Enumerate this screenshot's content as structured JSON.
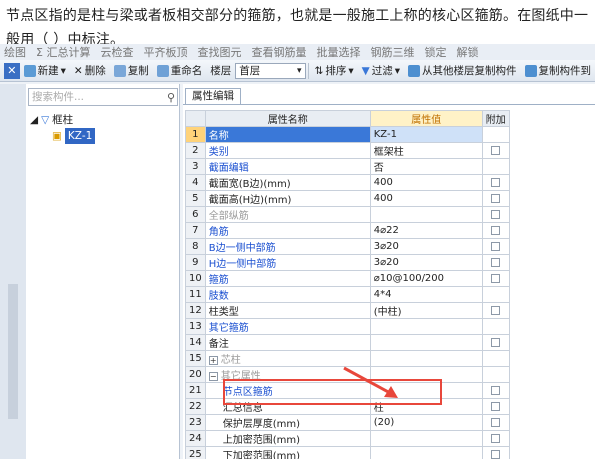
{
  "question": "节点区指的是柱与梁或者板相交部分的箍筋，也就是一般施工上称的核心区箍筋。在图纸中一般用（ ）中标注。",
  "top_toolbar": [
    "绘图",
    "Σ 汇总计算",
    "云检查",
    "平齐板顶",
    "查找图元",
    "查看钢筋量",
    "批量选择",
    "钢筋三维",
    "锁定",
    "解锁"
  ],
  "toolbar": {
    "new": "新建",
    "delete": "删除",
    "copy": "复制",
    "rename": "重命名",
    "floor_label": "楼层",
    "floor_value": "首层",
    "sort": "排序",
    "filter": "过滤",
    "copy_from_floor": "从其他楼层复制构件",
    "copy_to": "复制构件到"
  },
  "left_panel": {
    "search_placeholder": "搜索构件...",
    "tree": {
      "parent": "框柱",
      "child": "KZ-1"
    }
  },
  "property_tab": "属性编辑",
  "grid": {
    "headers": {
      "name": "属性名称",
      "value": "属性值",
      "add": "附加"
    },
    "rows": [
      {
        "num": "1",
        "name": "名称",
        "value": "KZ-1",
        "style": "link",
        "checkbox": false,
        "selected": true
      },
      {
        "num": "2",
        "name": "类别",
        "value": "框架柱",
        "style": "link",
        "checkbox": true
      },
      {
        "num": "3",
        "name": "截面编辑",
        "value": "否",
        "style": "link",
        "checkbox": false
      },
      {
        "num": "4",
        "name": "截面宽(B边)(mm)",
        "value": "400",
        "style": "normal",
        "checkbox": true
      },
      {
        "num": "5",
        "name": "截面高(H边)(mm)",
        "value": "400",
        "style": "normal",
        "checkbox": true
      },
      {
        "num": "6",
        "name": "全部纵筋",
        "value": "",
        "style": "gray",
        "checkbox": true
      },
      {
        "num": "7",
        "name": "角筋",
        "value": "4⌀22",
        "style": "link",
        "checkbox": true
      },
      {
        "num": "8",
        "name": "B边一侧中部筋",
        "value": "3⌀20",
        "style": "link",
        "checkbox": true
      },
      {
        "num": "9",
        "name": "H边一侧中部筋",
        "value": "3⌀20",
        "style": "link",
        "checkbox": true
      },
      {
        "num": "10",
        "name": "箍筋",
        "value": "⌀10@100/200",
        "style": "link",
        "checkbox": true
      },
      {
        "num": "11",
        "name": "肢数",
        "value": "4*4",
        "style": "link",
        "checkbox": false
      },
      {
        "num": "12",
        "name": "柱类型",
        "value": "(中柱)",
        "style": "normal",
        "checkbox": true
      },
      {
        "num": "13",
        "name": "其它箍筋",
        "value": "",
        "style": "link",
        "checkbox": false
      },
      {
        "num": "14",
        "name": "备注",
        "value": "",
        "style": "normal",
        "checkbox": true
      },
      {
        "num": "15",
        "name": "芯柱",
        "value": "",
        "style": "gray",
        "checkbox": false,
        "expander": "+"
      },
      {
        "num": "20",
        "name": "其它属性",
        "value": "",
        "style": "gray",
        "checkbox": false,
        "expander": "−"
      },
      {
        "num": "21",
        "name": "节点区箍筋",
        "value": "",
        "style": "link",
        "checkbox": true,
        "indent": true
      },
      {
        "num": "22",
        "name": "汇总信息",
        "value": "柱",
        "style": "normal",
        "checkbox": true,
        "indent": true
      },
      {
        "num": "23",
        "name": "保护层厚度(mm)",
        "value": "(20)",
        "style": "normal",
        "checkbox": true,
        "indent": true
      },
      {
        "num": "24",
        "name": "上加密范围(mm)",
        "value": "",
        "style": "normal",
        "checkbox": true,
        "indent": true
      },
      {
        "num": "25",
        "name": "下加密范围(mm)",
        "value": "",
        "style": "normal",
        "checkbox": true,
        "indent": true
      }
    ]
  },
  "colors": {
    "highlight_box": "#e8473b",
    "arrow": "#e8473b"
  }
}
